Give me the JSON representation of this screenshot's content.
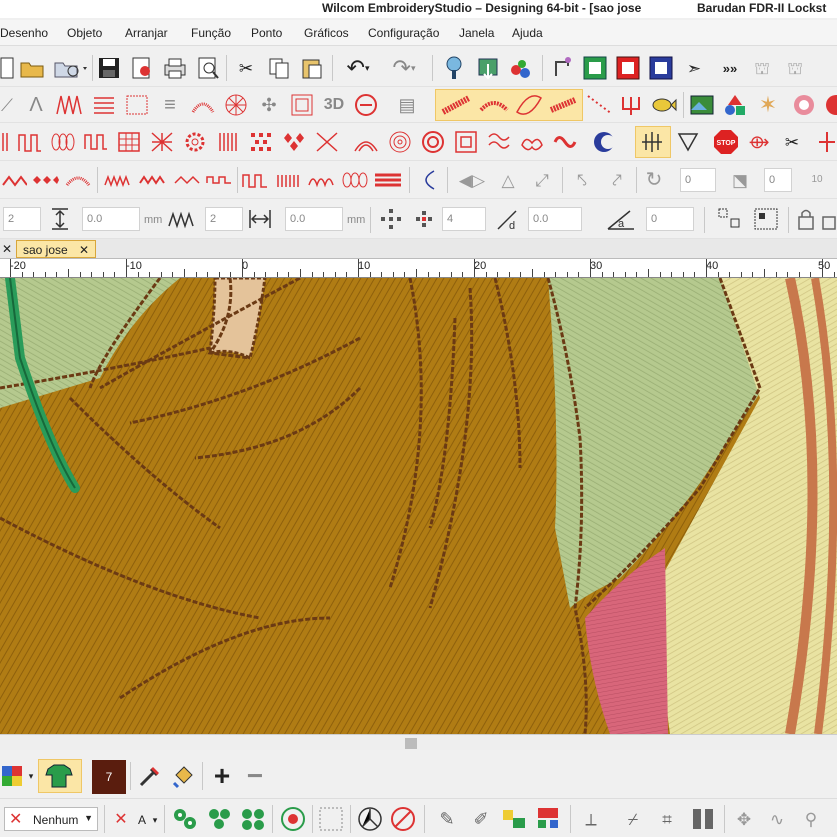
{
  "title": {
    "main": "Wilcom EmbroideryStudio – Designing 64-bit - [sao jose",
    "machine": "Barudan FDR-II Lockst"
  },
  "menu": [
    "Desenho",
    "Objeto",
    "Arranjar",
    "Função",
    "Ponto",
    "Gráficos",
    "Configuração",
    "Janela",
    "Ajuda"
  ],
  "toolbar_row2": {
    "three_d_label": "3D"
  },
  "toolbar_row3": {
    "stop_label": "STOP"
  },
  "toolbar_row4": {
    "value1": "0",
    "value2": "0",
    "value3": "10"
  },
  "toolbar_row5": {
    "field1": "2",
    "field2": "0.0",
    "unit1": "mm",
    "field3": "2",
    "field4": "0.0",
    "unit2": "mm",
    "field5": "4",
    "field6": "0.0",
    "field7": "0"
  },
  "tabs": {
    "active": "sao jose"
  },
  "ruler": {
    "labels": [
      "-20",
      "-10",
      "0",
      "10",
      "20",
      "30",
      "40",
      "50"
    ]
  },
  "palette": {
    "current_color_number": "7",
    "current_color": "#5a1d0e"
  },
  "bottom": {
    "dropdown_value": "Nenhum",
    "a_label": "A"
  },
  "colors": {
    "accent": "#fbe6a6",
    "design_gold": "#b07c14",
    "design_green": "#b5c98e",
    "design_pink": "#d8667a",
    "design_yellow": "#e9e3a2",
    "design_copper": "#c8784c"
  }
}
